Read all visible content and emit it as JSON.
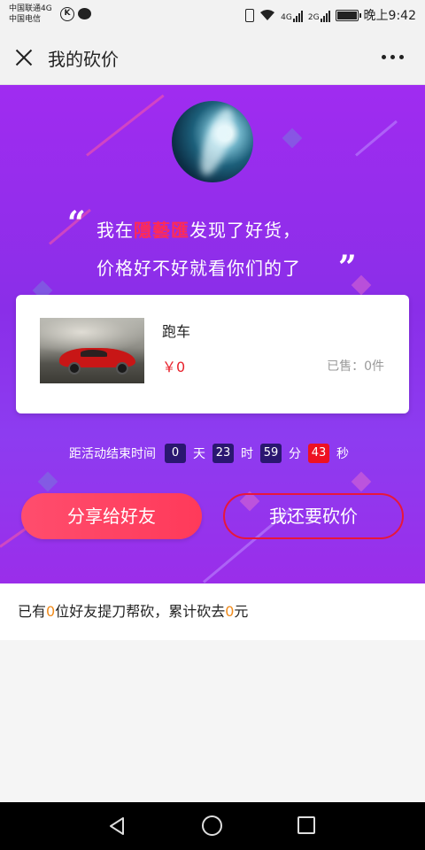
{
  "status_bar": {
    "carrier_line1": "中国联通4G",
    "carrier_line2": "中国电信",
    "net1": "4G",
    "net2": "2G",
    "time": "晚上9:42"
  },
  "header": {
    "title": "我的砍价"
  },
  "hero": {
    "slogan_pre": "我在",
    "slogan_highlight": "隱藝匯",
    "slogan_post": "发现了好货，",
    "slogan_line2": "价格好不好就看你们的了",
    "open_quote": "“",
    "close_quote": "”"
  },
  "product": {
    "name": "跑车",
    "price": "￥0",
    "sold_label": "已售：",
    "sold_value": "0件"
  },
  "countdown": {
    "label": "距活动结束时间",
    "days": "0",
    "days_unit": "天",
    "hours": "23",
    "hours_unit": "时",
    "minutes": "59",
    "minutes_unit": "分",
    "seconds": "43",
    "seconds_unit": "秒"
  },
  "actions": {
    "share_label": "分享给好友",
    "bargain_label": "我还要砍价"
  },
  "info": {
    "pre": "已有",
    "friends_count": "0",
    "mid": "位好友提刀帮砍，累计砍去",
    "amount": "0",
    "post": "元"
  },
  "colors": {
    "hero_purple": "#8a2ee8",
    "highlight_red": "#ff2a57",
    "price_red": "#e8222c",
    "share_button": "#ff4d6d",
    "countdown_box": "#2a1770",
    "countdown_seconds": "#ee1122",
    "info_number": "#f08a1a"
  },
  "icons": {
    "close": "close-icon",
    "more": "more-icon",
    "nav_back": "triangle-back-icon",
    "nav_home": "circle-home-icon",
    "nav_recent": "square-recent-icon"
  }
}
